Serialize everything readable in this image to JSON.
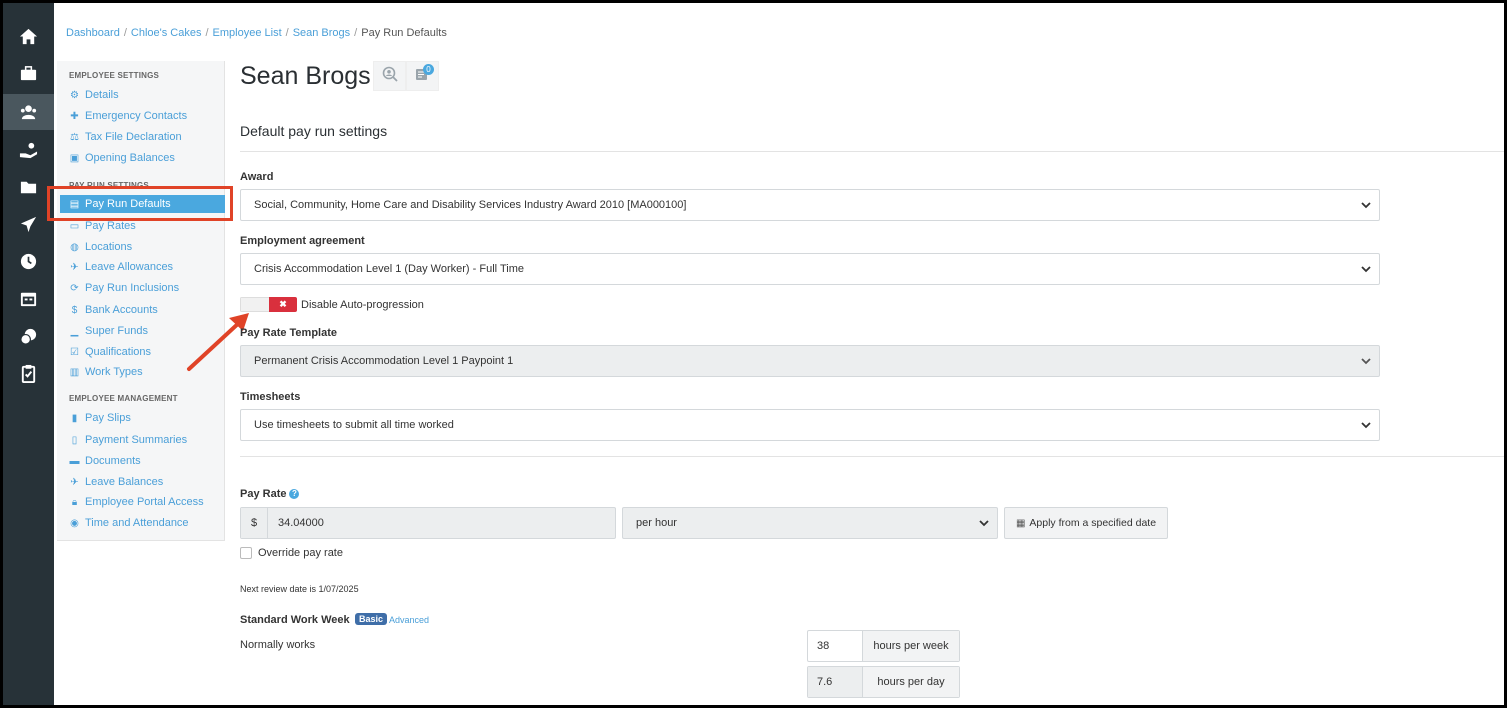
{
  "breadcrumb": {
    "items": [
      "Dashboard",
      "Chloe's Cakes",
      "Employee List",
      "Sean Brogs"
    ],
    "current": "Pay Run Defaults"
  },
  "rail": {
    "icons": [
      "home-icon",
      "briefcase-icon",
      "users-icon",
      "hand-coin-icon",
      "folder-icon",
      "plane-icon",
      "clock-icon",
      "calendar-icon",
      "coins-icon",
      "clipboard-icon"
    ],
    "active": "users-icon"
  },
  "sidebar": {
    "employee_settings_heading": "EMPLOYEE SETTINGS",
    "employee_settings": [
      {
        "label": "Details",
        "icon": "gear-icon"
      },
      {
        "label": "Emergency Contacts",
        "icon": "plus-icon"
      },
      {
        "label": "Tax File Declaration",
        "icon": "scale-icon"
      },
      {
        "label": "Opening Balances",
        "icon": "wallet-icon"
      }
    ],
    "pay_run_settings_heading": "PAY RUN SETTINGS",
    "pay_run_settings": [
      {
        "label": "Pay Run Defaults",
        "icon": "clipboard-icon",
        "active": true
      },
      {
        "label": "Pay Rates",
        "icon": "money-icon"
      },
      {
        "label": "Locations",
        "icon": "globe-icon"
      },
      {
        "label": "Leave Allowances",
        "icon": "plane-icon"
      },
      {
        "label": "Pay Run Inclusions",
        "icon": "refresh-icon"
      },
      {
        "label": "Bank Accounts",
        "icon": "dollar-circle-icon"
      },
      {
        "label": "Super Funds",
        "icon": "bar-chart-icon"
      },
      {
        "label": "Qualifications",
        "icon": "check-square-icon"
      },
      {
        "label": "Work Types",
        "icon": "book-icon"
      }
    ],
    "employee_management_heading": "EMPLOYEE MANAGEMENT",
    "employee_management": [
      {
        "label": "Pay Slips",
        "icon": "file-icon"
      },
      {
        "label": "Payment Summaries",
        "icon": "document-icon"
      },
      {
        "label": "Documents",
        "icon": "folder-icon"
      },
      {
        "label": "Leave Balances",
        "icon": "plane-icon"
      },
      {
        "label": "Employee Portal Access",
        "icon": "lock-icon"
      },
      {
        "label": "Time and Attendance",
        "icon": "user-clock-icon"
      }
    ]
  },
  "header": {
    "employee_name": "Sean Brogs",
    "notes_badge": "0"
  },
  "form": {
    "section_title": "Default pay run settings",
    "award_label": "Award",
    "award_value": "Social, Community, Home Care and Disability Services Industry Award 2010 [MA000100]",
    "agreement_label": "Employment agreement",
    "agreement_value": "Crisis Accommodation Level 1 (Day Worker) - Full Time",
    "toggle_symbol": "✖",
    "toggle_label": "Disable Auto-progression",
    "template_label": "Pay Rate Template",
    "template_value": "Permanent Crisis Accommodation Level 1 Paypoint 1",
    "timesheets_label": "Timesheets",
    "timesheets_value": "Use timesheets to submit all time worked",
    "pay_rate_label": "Pay Rate",
    "pay_rate_help": "?",
    "currency": "$",
    "pay_rate_value": "34.04000",
    "pay_rate_unit": "per hour",
    "apply_button": "Apply from a specified date",
    "override_label": "Override pay rate",
    "review_text": "Next review date is 1/07/2025",
    "sww_label": "Standard Work Week",
    "sww_basic": "Basic",
    "sww_advanced": "Advanced",
    "normally_works": "Normally works",
    "hours_per_week_value": "38",
    "hours_per_week_unit": "hours per week",
    "hours_per_day_value": "7.6",
    "hours_per_day_unit": "hours per day"
  },
  "colors": {
    "rail_bg": "#273238",
    "link": "#4a9fd8",
    "active_item": "#4aa8df",
    "annotation": "#e04327",
    "toggle_on": "#d9303d"
  }
}
